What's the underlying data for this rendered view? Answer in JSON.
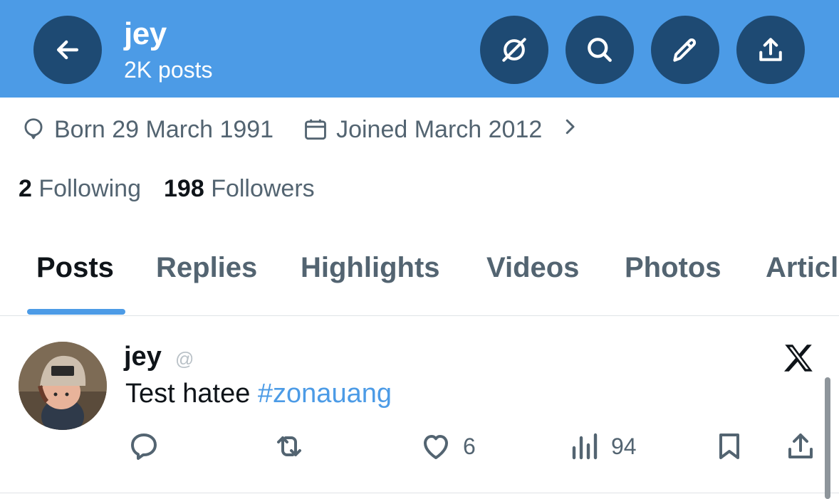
{
  "header": {
    "title": "jey",
    "subtitle": "2K posts",
    "back_icon": "arrow-left-icon",
    "actions": [
      "grok-icon",
      "search-icon",
      "edit-pencil-icon",
      "share-icon"
    ],
    "bar_color": "#4c9be6",
    "button_color": "#1e4a73"
  },
  "profile": {
    "born": "Born 29 March 1991",
    "joined": "Joined March 2012",
    "following_count": "2",
    "following_label": "Following",
    "followers_count": "198",
    "followers_label": "Followers"
  },
  "tabs": [
    {
      "label": "Posts",
      "active": true
    },
    {
      "label": "Replies",
      "active": false
    },
    {
      "label": "Highlights",
      "active": false
    },
    {
      "label": "Videos",
      "active": false
    },
    {
      "label": "Photos",
      "active": false
    },
    {
      "label": "Articles",
      "active": false
    }
  ],
  "post": {
    "author_name": "jey",
    "text_plain": "Test hatee ",
    "hashtag": "#zonauang",
    "likes": "6",
    "views": "94",
    "link_color": "#4c9be6"
  }
}
